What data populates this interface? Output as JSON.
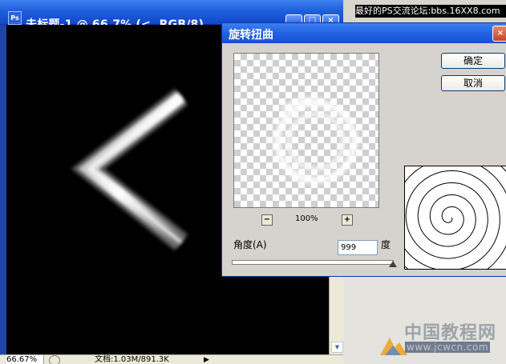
{
  "doc_window": {
    "app_icon_text": "Ps",
    "title": "未标题-1 @ 66.7% (<, RGB/8)",
    "min_label": "_",
    "max_label": "□",
    "close_label": "×",
    "scroll_up": "▲",
    "scroll_down": "▼",
    "status": {
      "zoom": "66.67%",
      "doc_info": "文档:1.03M/891.3K",
      "arrow": "▶"
    }
  },
  "site_strip": "最好的PS交流论坛:bbs.16XX8.com",
  "twirl_dialog": {
    "title": "旋转扭曲",
    "close_label": "×",
    "ok_label": "确定",
    "cancel_label": "取消",
    "zoom_out_label": "−",
    "zoom_in_label": "+",
    "zoom_level": "100%",
    "angle_label": "角度(A)",
    "angle_value": "999",
    "angle_unit": "度",
    "angle_slider": {
      "value": 999,
      "min": -999,
      "max": 999
    }
  },
  "watermark": {
    "title": "中国教程网",
    "url": "www.jcwcn.com"
  },
  "colors": {
    "xp_title_blue": "#1f5fdd",
    "dialog_face": "#d6d3ce",
    "canvas": "#000000"
  }
}
